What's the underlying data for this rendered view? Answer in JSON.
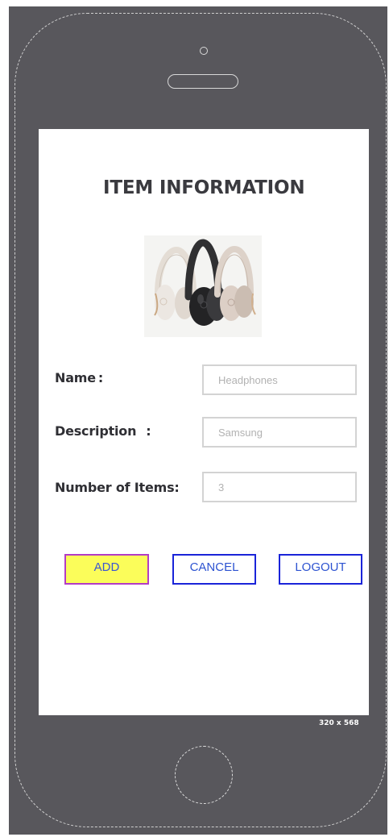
{
  "screen": {
    "title": "ITEM INFORMATION",
    "size_label": "320 x 568"
  },
  "product_image": {
    "icon": "headphones-icon",
    "colors": [
      "#e8e0d6",
      "#2f2f31",
      "#d5c8bf"
    ]
  },
  "form": {
    "name_label": "Name",
    "name_colon": ":",
    "name_value": "Headphones",
    "description_label": "Description",
    "description_colon": ":",
    "description_value": "Samsung",
    "items_label": "Number of Items:",
    "items_value": "3"
  },
  "buttons": {
    "add_label": "ADD",
    "cancel_label": "CANCEL",
    "logout_label": "LOGOUT"
  },
  "colors": {
    "frame": "#58575c",
    "screen": "#ffffff",
    "button_text": "#2d53d1",
    "add_background": "#fbfd5a",
    "add_border": "#b23cc5",
    "outline_button_border": "#1a24d9"
  }
}
